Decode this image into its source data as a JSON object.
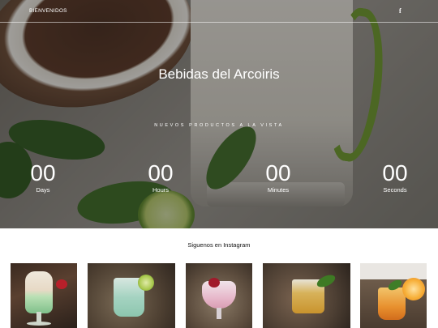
{
  "header": {
    "brand_label": "BIENVENIDOS",
    "social_icon": "facebook-icon",
    "social_glyph": "f"
  },
  "hero": {
    "title": "Bebidas del Arcoiris",
    "subtitle": "NUEVOS PRODUCTOS A LA VISTA"
  },
  "countdown": {
    "days": {
      "value": "00",
      "label": "Days"
    },
    "hours": {
      "value": "00",
      "label": "Hours"
    },
    "minutes": {
      "value": "00",
      "label": "Minutes"
    },
    "seconds": {
      "value": "00",
      "label": "Seconds"
    }
  },
  "instagram": {
    "title": "Siguenos en Instagram",
    "photos": [
      {
        "subject": "green-layered-cocktail-with-whipped-cream"
      },
      {
        "subject": "mint-lime-drink"
      },
      {
        "subject": "pink-berry-smoothie"
      },
      {
        "subject": "golden-drink-with-mint"
      },
      {
        "subject": "orange-drink-with-orange-slice"
      }
    ]
  },
  "colors": {
    "text_on_hero": "#ffffff",
    "page_background": "#ffffff",
    "instagram_title": "#111111"
  }
}
